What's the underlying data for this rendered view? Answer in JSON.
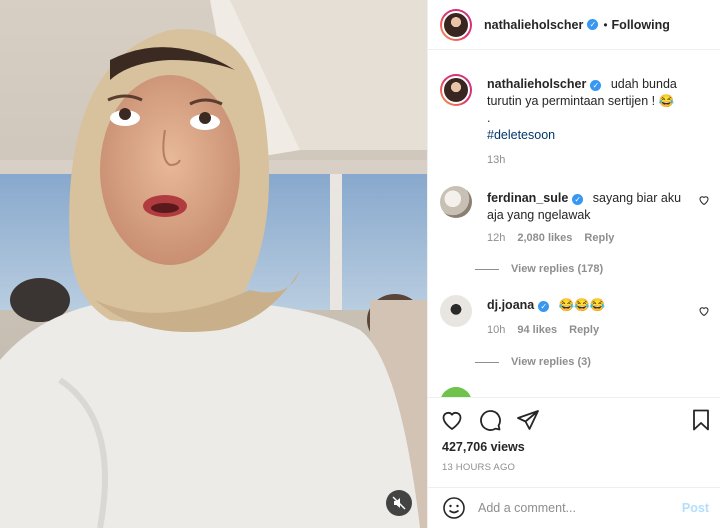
{
  "header": {
    "username": "nathalieholscher",
    "separator": "•",
    "follow_label": "Following"
  },
  "caption": {
    "username": "nathalieholscher",
    "text": "udah bunda turutin ya permintaan sertijen ! 😂",
    "dot_line": ".",
    "hashtag": "#deletesoon",
    "time": "13h"
  },
  "comments": [
    {
      "username": "ferdinan_sule",
      "text": "sayang biar aku aja yang ngelawak",
      "time": "12h",
      "likes": "2,080 likes",
      "reply_label": "Reply",
      "view_replies": "View replies (178)"
    },
    {
      "username": "dj.joana",
      "text": "😂😂😂",
      "time": "10h",
      "likes": "94 likes",
      "reply_label": "Reply",
      "view_replies": "View replies (3)"
    }
  ],
  "post": {
    "views": "427,706 views",
    "posted": "13 HOURS AGO"
  },
  "add_comment": {
    "placeholder": "Add a comment...",
    "post_label": "Post"
  },
  "icons": {
    "like": "heart-icon",
    "comment": "comment-icon",
    "share": "share-icon",
    "save": "bookmark-icon",
    "emoji": "emoji-icon",
    "mute": "muted-speaker-icon",
    "verified": "verified-badge-icon"
  },
  "colors": {
    "verified_blue": "#3897f0",
    "hashtag": "#00376b",
    "muted_text": "#8e8e8e",
    "post_disabled": "#b2dffc"
  }
}
